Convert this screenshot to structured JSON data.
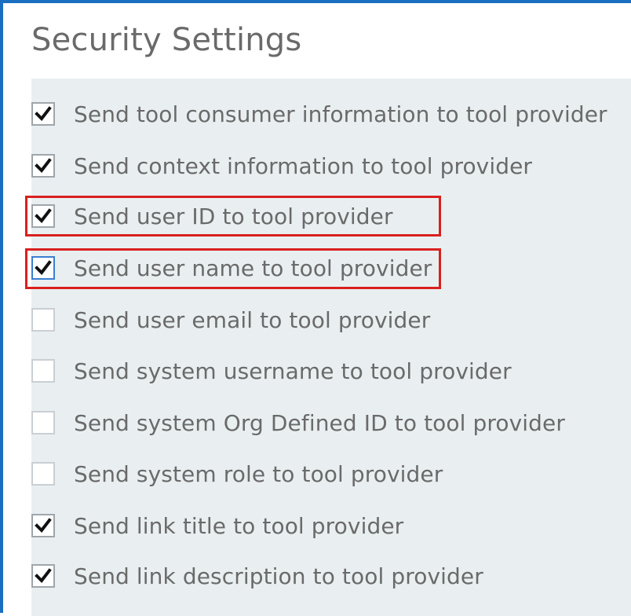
{
  "title": "Security Settings",
  "colors": {
    "accent_border": "#1a6fc0",
    "panel_bg": "#e9eff1",
    "text": "#6a6a6a",
    "highlight": "#d9201f",
    "focus": "#3b7fd1"
  },
  "settings": [
    {
      "label": "Send tool consumer information to tool provider",
      "checked": true,
      "icon": "checkmark-icon"
    },
    {
      "label": "Send context information to tool provider",
      "checked": true,
      "icon": "checkmark-icon"
    },
    {
      "label": "Send user ID to tool provider",
      "checked": true,
      "icon": "checkmark-icon",
      "highlighted": true
    },
    {
      "label": "Send user name to tool provider",
      "checked": true,
      "icon": "checkmark-icon",
      "highlighted": true,
      "focused": true
    },
    {
      "label": "Send user email to tool provider",
      "checked": false
    },
    {
      "label": "Send system username to tool provider",
      "checked": false
    },
    {
      "label": "Send system Org Defined ID to tool provider",
      "checked": false
    },
    {
      "label": "Send system role to tool provider",
      "checked": false
    },
    {
      "label": "Send link title to tool provider",
      "checked": true,
      "icon": "checkmark-icon"
    },
    {
      "label": "Send link description to tool provider",
      "checked": true,
      "icon": "checkmark-icon"
    }
  ]
}
